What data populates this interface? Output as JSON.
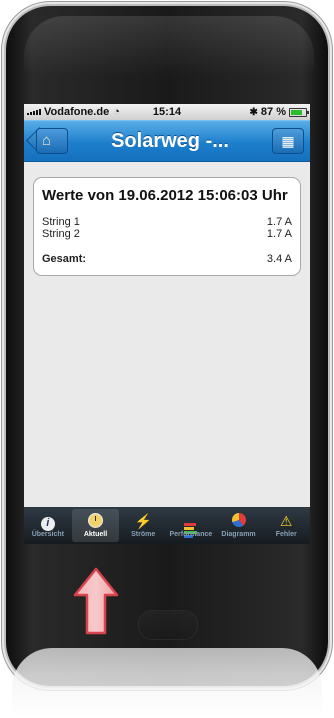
{
  "status_bar": {
    "carrier": "Vodafone.de",
    "time": "15:14",
    "battery": "87 %",
    "battery_level": 0.87
  },
  "nav": {
    "title": "Solarweg -...",
    "home_icon": "home-icon",
    "right_icon": "calendar-clock-icon"
  },
  "card": {
    "heading": "Werte von 19.06.2012 15:06:03 Uhr",
    "rows": [
      {
        "label": "String 1",
        "value": "1.7 A"
      },
      {
        "label": "String 2",
        "value": "1.7 A"
      }
    ],
    "total_label": "Gesamt:",
    "total_value": "3.4 A"
  },
  "tabs": [
    {
      "label": "Übersicht",
      "icon": "info-icon"
    },
    {
      "label": "Aktuell",
      "icon": "clock-icon",
      "active": true
    },
    {
      "label": "Ströme",
      "icon": "bolt-icon"
    },
    {
      "label": "Performance",
      "icon": "bars-icon"
    },
    {
      "label": "Diagramm",
      "icon": "pie-chart-icon"
    },
    {
      "label": "Fehler",
      "icon": "warning-icon"
    }
  ],
  "colors": {
    "nav_blue": "#1d7fcc",
    "tabbar": "#1c232a",
    "arrow_red": "#e8535a"
  }
}
